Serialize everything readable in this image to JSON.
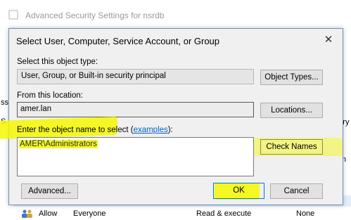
{
  "background_window": {
    "title": "Advanced Security Settings for nsrdb",
    "fragment_right_entry": "entry",
    "fragment_right_from": "from",
    "fragment_left_s1": "ss",
    "fragment_left_s2": "S",
    "row": {
      "access": "Allow",
      "principal": "Everyone",
      "permission": "Read & execute",
      "inherited": "None"
    }
  },
  "dialog": {
    "title": "Select User, Computer, Service Account, or Group",
    "object_type_label": "Select this object type:",
    "object_type_value": "User, Group, or Built-in security principal",
    "object_types_button": "Object Types...",
    "location_label": "From this location:",
    "location_value": "amer.lan",
    "locations_button": "Locations...",
    "names_label_prefix": "Enter the object name to select (",
    "examples_link": "examples",
    "names_label_suffix": "):",
    "names_value": "AMER\\Administrators",
    "check_names_button": "Check Names",
    "advanced_button": "Advanced...",
    "ok_button": "OK",
    "cancel_button": "Cancel",
    "close_glyph": "✕"
  },
  "colors": {
    "dialog_bg": "#f0f0f0",
    "highlighter": "#f4f800",
    "link": "#0066cc",
    "focus_border": "#0078d7"
  }
}
